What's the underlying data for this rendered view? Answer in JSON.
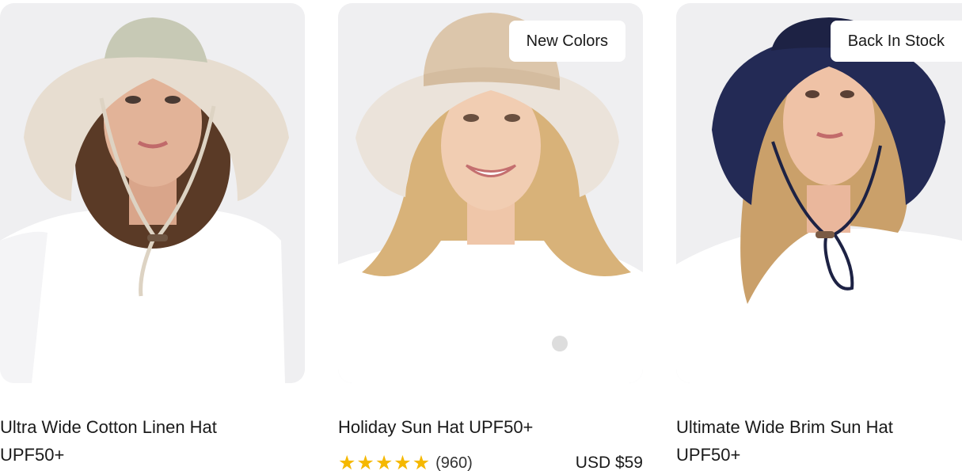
{
  "products": [
    {
      "title_line1": "Ultra Wide Cotton Linen Hat",
      "title_line2": "UPF50+",
      "hat_color": "#c7c9b5",
      "brim_color": "#e7ddd0"
    },
    {
      "badge": "New Colors",
      "title": "Holiday Sun Hat UPF50+",
      "rating": 5,
      "stars": [
        "★",
        "★",
        "★",
        "★",
        "★"
      ],
      "review_count": "(960)",
      "price": "USD $59",
      "hat_color": "#dcc6ab",
      "brim_color": "#ebe3da"
    },
    {
      "badge": "Back In Stock",
      "title_line1": "Ultimate Wide Brim Sun Hat",
      "title_line2": "UPF50+",
      "hat_color": "#1d2244",
      "brim_color": "#232a55"
    }
  ],
  "colors": {
    "star": "#f5b800",
    "card_bg": "#efeff1",
    "badge_bg": "#ffffff"
  }
}
